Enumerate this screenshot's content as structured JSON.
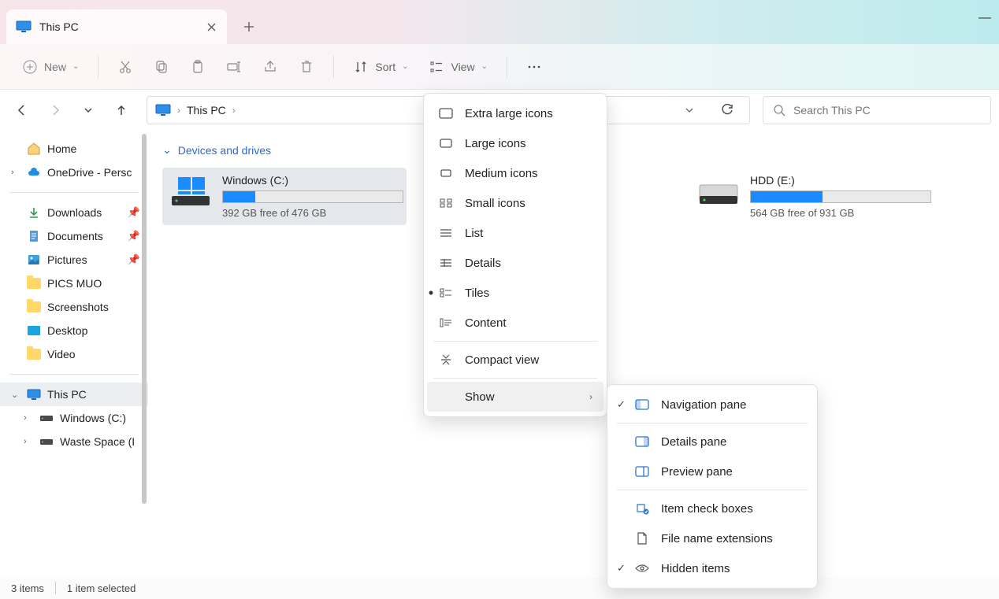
{
  "titlebar": {
    "tab_title": "This PC",
    "minimize_glyph": "—"
  },
  "toolbar": {
    "new_label": "New",
    "sort_label": "Sort",
    "view_label": "View"
  },
  "nav": {
    "breadcrumb": "This PC"
  },
  "search": {
    "placeholder": "Search This PC"
  },
  "sidebar": {
    "home": "Home",
    "onedrive": "OneDrive - Persc",
    "downloads": "Downloads",
    "documents": "Documents",
    "pictures": "Pictures",
    "pics_muo": "PICS MUO",
    "screenshots": "Screenshots",
    "desktop": "Desktop",
    "video": "Video",
    "this_pc": "This PC",
    "windows_c": "Windows (C:)",
    "waste_space": "Waste Space (I"
  },
  "content": {
    "section_header": "Devices and drives",
    "drives": [
      {
        "name": "Windows (C:)",
        "free": "392 GB free of 476 GB",
        "fill_pct": 18
      },
      {
        "name": "HDD (E:)",
        "free": "564 GB free of 931 GB",
        "fill_pct": 40
      }
    ]
  },
  "view_menu": {
    "extra_large": "Extra large icons",
    "large": "Large icons",
    "medium": "Medium icons",
    "small": "Small icons",
    "list": "List",
    "details": "Details",
    "tiles": "Tiles",
    "content": "Content",
    "compact": "Compact view",
    "show": "Show"
  },
  "show_menu": {
    "nav_pane": "Navigation pane",
    "details_pane": "Details pane",
    "preview_pane": "Preview pane",
    "check_boxes": "Item check boxes",
    "extensions": "File name extensions",
    "hidden": "Hidden items"
  },
  "status": {
    "items": "3 items",
    "selected": "1 item selected"
  }
}
